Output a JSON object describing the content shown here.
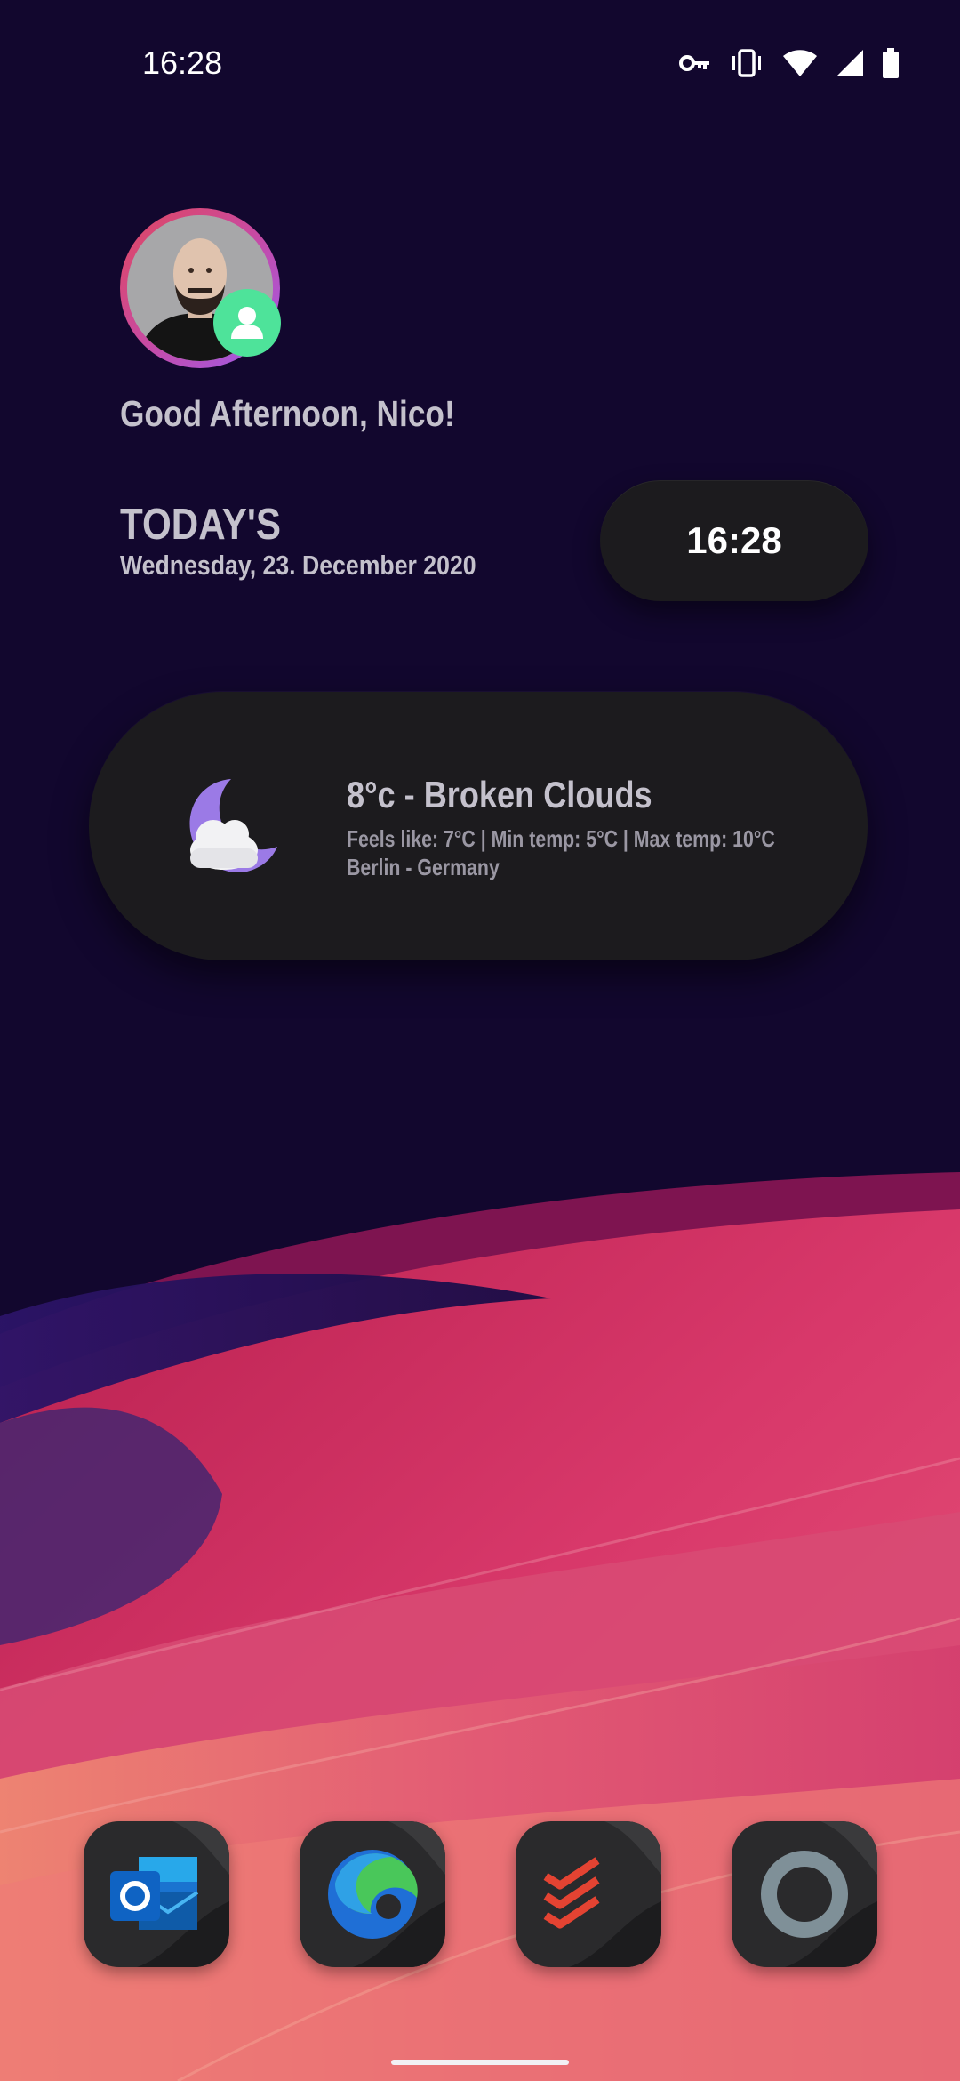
{
  "status_bar": {
    "time": "16:28",
    "icons": [
      "vpn-key-icon",
      "vibrate-icon",
      "wifi-icon",
      "cellular-signal-icon",
      "battery-icon"
    ]
  },
  "profile": {
    "greeting": "Good Afternoon, Nico!",
    "badge_icon": "person-icon",
    "badge_color": "#4ee39a"
  },
  "today": {
    "title": "TODAY'S",
    "date": "Wednesday, 23. December 2020"
  },
  "clock": {
    "time": "16:28"
  },
  "weather": {
    "icon": "moon-cloud-icon",
    "summary": "8°c - Broken Clouds",
    "details": "Feels like: 7°C | Min temp: 5°C | Max temp: 10°C",
    "location": "Berlin - Germany"
  },
  "dock": {
    "apps": [
      {
        "name": "Outlook",
        "icon": "outlook-icon"
      },
      {
        "name": "Edge",
        "icon": "edge-icon"
      },
      {
        "name": "Todoist",
        "icon": "todoist-icon"
      },
      {
        "name": "Ring app",
        "icon": "ring-icon"
      }
    ]
  },
  "colors": {
    "background": "#12072e",
    "card": "#1c1b1e",
    "text": "#c4c1cc",
    "accent_pink": "#e0475e",
    "accent_purple": "#9b5cf0"
  }
}
